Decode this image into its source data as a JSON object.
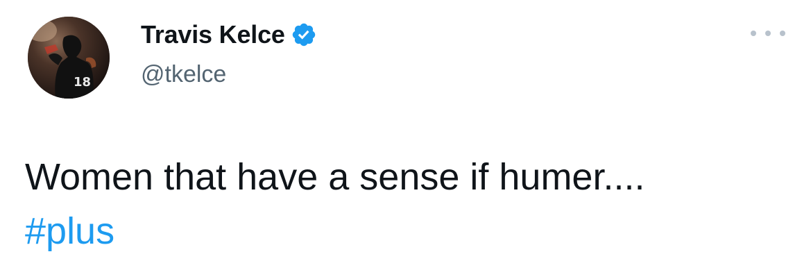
{
  "author": {
    "display_name": "Travis Kelce",
    "handle": "@tkelce",
    "verified": true,
    "avatar": "avatar-photo-football-player",
    "verified_icon": "verified-badge-icon"
  },
  "menu": {
    "icon": "more-options-icon"
  },
  "tweet": {
    "text": "Women that have a sense if humer....",
    "hashtag": "#plus"
  },
  "colors": {
    "text": "#0f1419",
    "secondary_text": "#536471",
    "link": "#1d9bf0",
    "verified_badge": "#1d9bf0",
    "background": "#ffffff"
  }
}
